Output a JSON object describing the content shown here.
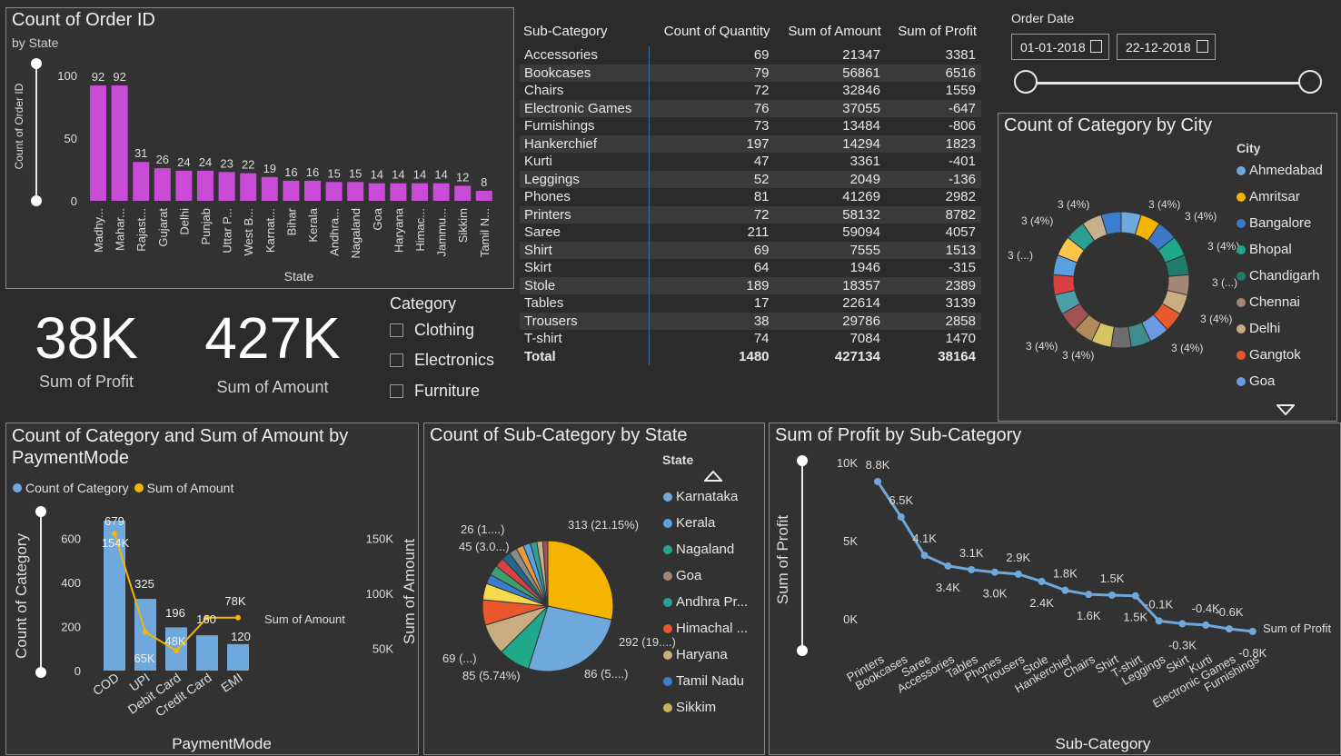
{
  "kpis": {
    "profit_value": "38K",
    "profit_label": "Sum of Profit",
    "amount_value": "427K",
    "amount_label": "Sum of Amount"
  },
  "category_slicer": {
    "title": "Category",
    "options": [
      "Clothing",
      "Electronics",
      "Furniture"
    ]
  },
  "date_slicer": {
    "title": "Order Date",
    "start": "01-01-2018",
    "end": "22-12-2018"
  },
  "table": {
    "headers": [
      "Sub-Category",
      "Count of Quantity",
      "Sum of Amount",
      "Sum of Profit"
    ],
    "rows": [
      [
        "Accessories",
        "69",
        "21347",
        "3381"
      ],
      [
        "Bookcases",
        "79",
        "56861",
        "6516"
      ],
      [
        "Chairs",
        "72",
        "32846",
        "1559"
      ],
      [
        "Electronic Games",
        "76",
        "37055",
        "-647"
      ],
      [
        "Furnishings",
        "73",
        "13484",
        "-806"
      ],
      [
        "Hankerchief",
        "197",
        "14294",
        "1823"
      ],
      [
        "Kurti",
        "47",
        "3361",
        "-401"
      ],
      [
        "Leggings",
        "52",
        "2049",
        "-136"
      ],
      [
        "Phones",
        "81",
        "41269",
        "2982"
      ],
      [
        "Printers",
        "72",
        "58132",
        "8782"
      ],
      [
        "Saree",
        "211",
        "59094",
        "4057"
      ],
      [
        "Shirt",
        "69",
        "7555",
        "1513"
      ],
      [
        "Skirt",
        "64",
        "1946",
        "-315"
      ],
      [
        "Stole",
        "189",
        "18357",
        "2389"
      ],
      [
        "Tables",
        "17",
        "22614",
        "3139"
      ],
      [
        "Trousers",
        "38",
        "29786",
        "2858"
      ],
      [
        "T-shirt",
        "74",
        "7084",
        "1470"
      ]
    ],
    "total": [
      "Total",
      "1480",
      "427134",
      "38164"
    ]
  },
  "chart_data": [
    {
      "id": "order_by_state",
      "type": "bar",
      "title": "Count of Order ID",
      "subtitle": "by State",
      "xlabel": "State",
      "ylabel": "Count of Order ID",
      "ylim": [
        0,
        100
      ],
      "yticks": [
        "0",
        "50",
        "100"
      ],
      "color": "#c94bd8",
      "categories": [
        "Madhy...",
        "Mahar...",
        "Rajast...",
        "Gujarat",
        "Delhi",
        "Punjab",
        "Uttar P...",
        "West B...",
        "Karnat...",
        "Bihar",
        "Kerala",
        "Andhra...",
        "Nagaland",
        "Goa",
        "Haryana",
        "Himac...",
        "Jammu...",
        "Sikkim",
        "Tamil N..."
      ],
      "values": [
        92,
        92,
        31,
        26,
        24,
        24,
        23,
        22,
        19,
        16,
        16,
        15,
        15,
        14,
        14,
        14,
        14,
        12,
        8
      ]
    },
    {
      "id": "category_by_city",
      "type": "pie",
      "title": "Count of Category by City",
      "legend_title": "City",
      "legend": [
        "Ahmedabad",
        "Amritsar",
        "Bangalore",
        "Bhopal",
        "Chandigarh",
        "Chennai",
        "Delhi",
        "Gangtok",
        "Goa"
      ],
      "colors": [
        "#6fa8dc",
        "#f4b400",
        "#3d78c9",
        "#1fa88a",
        "#1f7d6a",
        "#a48676",
        "#c9ad80",
        "#e8582c",
        "#6b9be0",
        "#3c8f8d",
        "#6d6d6d",
        "#d8c266",
        "#b08a58",
        "#a35252",
        "#4d9fa8",
        "#d94141",
        "#5aa0e0",
        "#f7c64a",
        "#2ca093",
        "#c8b08a",
        "#3b7dcf"
      ],
      "labels": [
        "3 (4%)",
        "3 (4%)",
        "3 (4%)",
        "3 (...)",
        "3 (4%)",
        "3 (4%)",
        "3 (4%)",
        "3 (4%)",
        "3 (...)",
        "3 (4%)",
        "3 (4%)"
      ]
    },
    {
      "id": "category_amount_by_payment",
      "type": "bar",
      "title": "Count of Category and Sum of Amount by PaymentMode",
      "xlabel": "PaymentMode",
      "ylabel": "Count of Category",
      "y2label": "Sum of Amount",
      "categories": [
        "COD",
        "UPI",
        "Debit Card",
        "Credit Card",
        "EMI"
      ],
      "series": [
        {
          "name": "Count of Category",
          "color": "#6fa8dc",
          "values": [
            679,
            325,
            196,
            160,
            120
          ],
          "labels": [
            "679",
            "325",
            "196",
            "160",
            "120"
          ]
        },
        {
          "name": "Sum of Amount",
          "color": "#f4b400",
          "values": [
            154000,
            65000,
            48000,
            78000,
            78000
          ],
          "labels": [
            "154K",
            "65K",
            "48K",
            "78K",
            ""
          ]
        }
      ],
      "yticks": [
        "0",
        "200",
        "400",
        "600"
      ],
      "y2ticks": [
        "50K",
        "100K",
        "150K"
      ],
      "line_end_label": "Sum of Amount",
      "ylim": [
        0,
        700
      ],
      "y2lim": [
        30000,
        170000
      ]
    },
    {
      "id": "subcategory_by_state",
      "type": "pie",
      "title": "Count of Sub-Category by State",
      "legend_title": "State",
      "legend": [
        "Karnataka",
        "Kerala",
        "Nagaland",
        "Goa",
        "Andhra Pr...",
        "Himachal ...",
        "Haryana",
        "Tamil Nadu",
        "Sikkim"
      ],
      "values": [
        313,
        292,
        86,
        85,
        69,
        45,
        26
      ],
      "slice_labels": [
        "313 (21.15%)",
        "292 (19....)",
        "86 (5....)",
        "85 (5.74%)",
        "69 (...)",
        "45 (3.0...)",
        "26 (1....)"
      ]
    },
    {
      "id": "profit_by_subcategory",
      "type": "line",
      "title": "Sum of Profit by Sub-Category",
      "xlabel": "Sub-Category",
      "ylabel": "Sum of Profit",
      "ylim": [
        -1000,
        10000
      ],
      "yticks": [
        "0K",
        "5K",
        "10K"
      ],
      "series_end_label": "Sum of Profit",
      "color": "#6fa8dc",
      "categories": [
        "Printers",
        "Bookcases",
        "Saree",
        "Accessories",
        "Tables",
        "Phones",
        "Trousers",
        "Stole",
        "Hankerchief",
        "Chairs",
        "Shirt",
        "T-shirt",
        "Leggings",
        "Skirt",
        "Kurti",
        "Electronic Games",
        "Furnishings"
      ],
      "values": [
        8782,
        6516,
        4057,
        3381,
        3139,
        2982,
        2858,
        2389,
        1823,
        1559,
        1513,
        1470,
        -136,
        -315,
        -401,
        -647,
        -806
      ],
      "labels": [
        "8.8K",
        "6.5K",
        "4.1K",
        "3.4K",
        "3.1K",
        "3.0K",
        "2.9K",
        "2.4K",
        "1.8K",
        "1.6K",
        "1.5K",
        "1.5K",
        "-0.1K",
        "-0.3K",
        "-0.4K",
        "-0.6K",
        "-0.8K"
      ]
    }
  ]
}
